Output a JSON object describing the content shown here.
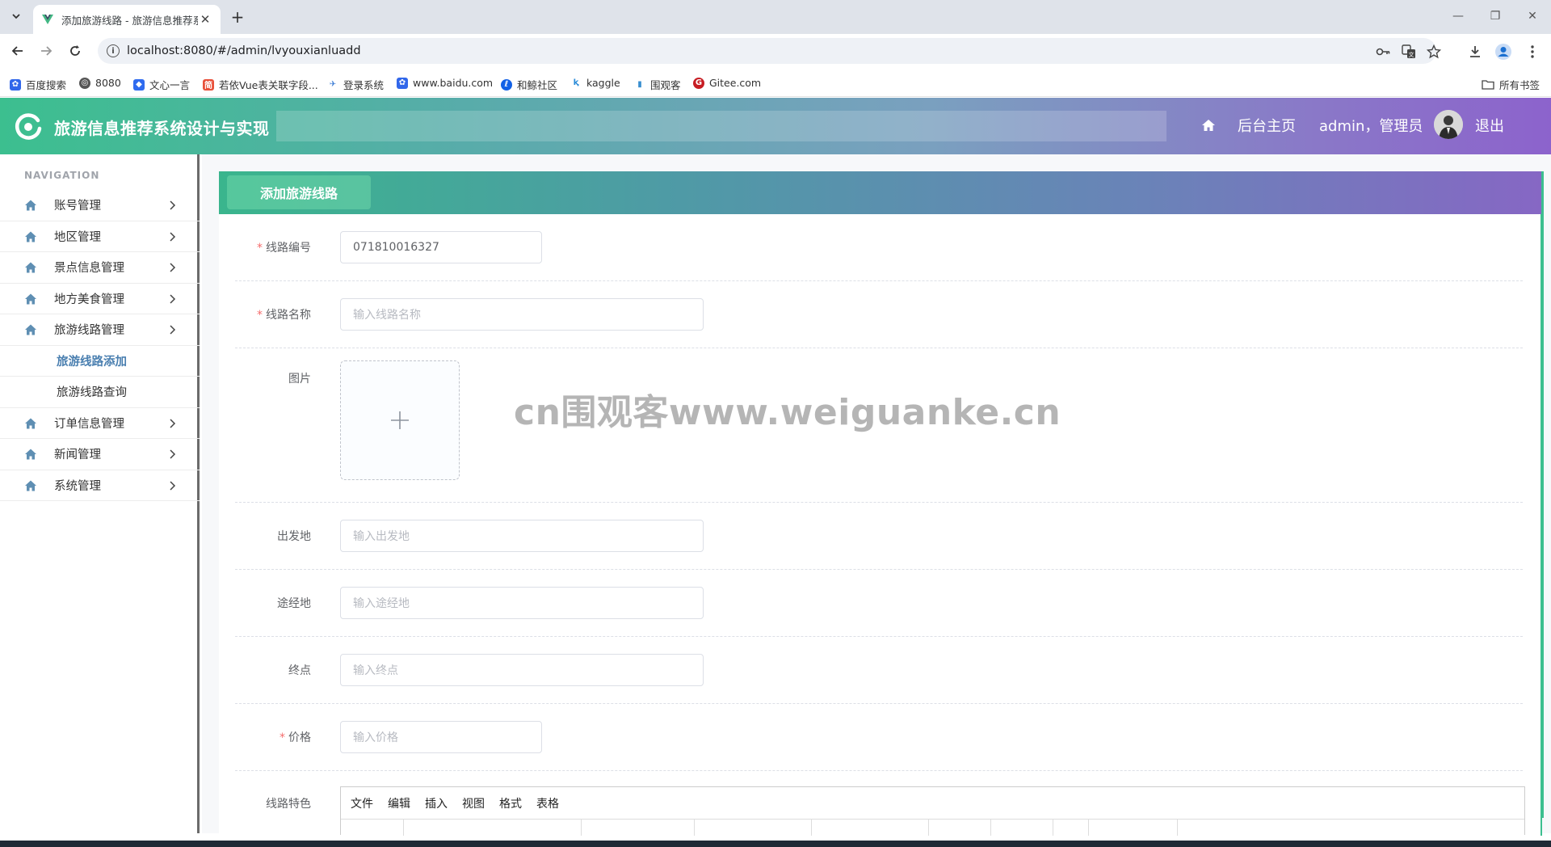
{
  "browser": {
    "tab_title": "添加旅游线路 - 旅游信息推荐系",
    "url": "localhost:8080/#/admin/lvyouxianluadd",
    "bookmarks": [
      "百度搜索",
      "8080",
      "文心一言",
      "若依Vue表关联字段...",
      "登录系统",
      "www.baidu.com",
      "和鲸社区",
      "kaggle",
      "围观客",
      "Gitee.com"
    ],
    "all_bookmarks": "所有书签",
    "colors": {
      "accent_start": "#3cbf8f",
      "accent_end": "#8c63cc"
    }
  },
  "app": {
    "title": "旅游信息推荐系统设计与实现",
    "header": {
      "home_label": "后台主页",
      "user_label": "admin，管理员",
      "logout_label": "退出"
    }
  },
  "sidebar": {
    "heading": "NAVIGATION",
    "items": [
      {
        "label": "账号管理",
        "icon": "home-icon",
        "has_children": true
      },
      {
        "label": "地区管理",
        "icon": "home-icon",
        "has_children": true
      },
      {
        "label": "景点信息管理",
        "icon": "home-icon",
        "has_children": true
      },
      {
        "label": "地方美食管理",
        "icon": "home-icon",
        "has_children": true
      },
      {
        "label": "旅游线路管理",
        "icon": "home-icon",
        "has_children": true
      },
      {
        "label": "旅游线路添加",
        "sub": true,
        "active": true
      },
      {
        "label": "旅游线路查询",
        "sub": true
      },
      {
        "label": "订单信息管理",
        "icon": "home-icon",
        "has_children": true
      },
      {
        "label": "新闻管理",
        "icon": "home-icon",
        "has_children": true
      },
      {
        "label": "系统管理",
        "icon": "home-icon",
        "has_children": true
      }
    ]
  },
  "form": {
    "card_title": "添加旅游线路",
    "fields": {
      "route_no": {
        "label": "线路编号",
        "value": "071810016327",
        "required": true
      },
      "route_name": {
        "label": "线路名称",
        "placeholder": "输入线路名称",
        "required": true
      },
      "image": {
        "label": "图片"
      },
      "departure": {
        "label": "出发地",
        "placeholder": "输入出发地"
      },
      "via": {
        "label": "途经地",
        "placeholder": "输入途经地"
      },
      "destination": {
        "label": "终点",
        "placeholder": "输入终点"
      },
      "price": {
        "label": "价格",
        "placeholder": "输入价格",
        "required": true
      },
      "features": {
        "label": "线路特色"
      }
    },
    "editor_menu": [
      "文件",
      "编辑",
      "插入",
      "视图",
      "格式",
      "表格"
    ],
    "required_mark": "*"
  },
  "watermark": "cn围观客www.weiguanke.cn"
}
